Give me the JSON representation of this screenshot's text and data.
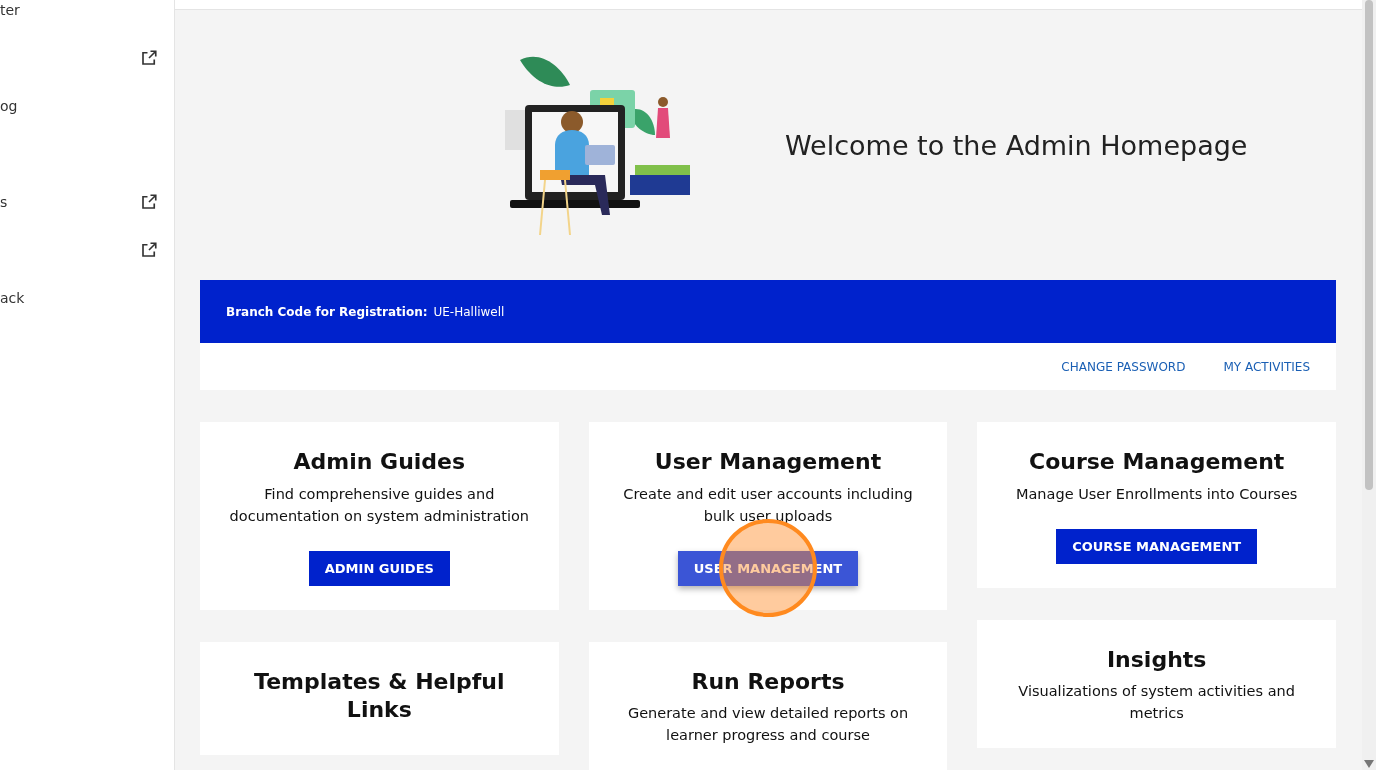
{
  "sidebar": {
    "items": [
      {
        "label": "ter",
        "external": false
      },
      {
        "external": true
      },
      {
        "label": "og",
        "external": false
      },
      {
        "external": false
      },
      {
        "label": "s",
        "external": true
      },
      {
        "external": true
      },
      {
        "label": "ack",
        "external": false
      }
    ]
  },
  "hero": {
    "title": "Welcome to the Admin Homepage"
  },
  "banner": {
    "label": "Branch Code for Registration:",
    "value": "UE-Halliwell"
  },
  "links": [
    "CHANGE PASSWORD",
    "MY ACTIVITIES"
  ],
  "columns": [
    [
      {
        "title": "Admin Guides",
        "description": "Find comprehensive guides and documentation on system administration",
        "button": {
          "label": "ADMIN GUIDES",
          "hovered": false
        }
      },
      {
        "title": "Templates & Helpful Links"
      }
    ],
    [
      {
        "title": "User Management",
        "description": "Create and edit user accounts including bulk user uploads",
        "button": {
          "label": "USER MANAGEMENT",
          "hovered": true
        }
      },
      {
        "title": "Run Reports",
        "description": "Generate and view detailed reports on learner progress and course"
      }
    ],
    [
      {
        "title": "Course Management",
        "description": "Manage User Enrollments into Courses",
        "button": {
          "label": "COURSE MANAGEMENT",
          "hovered": false
        }
      },
      {
        "title": "Insights",
        "description": "Visualizations of system activities and metrics"
      }
    ]
  ]
}
